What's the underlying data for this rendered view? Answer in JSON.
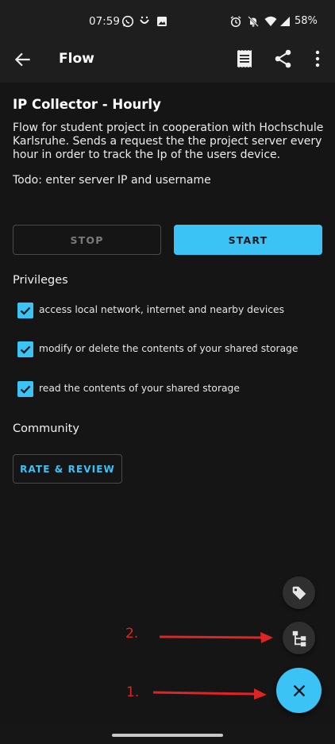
{
  "status_bar": {
    "time": "07:59",
    "battery": "58%",
    "icons": [
      "whatsapp-icon",
      "smile-app-icon",
      "image-icon",
      "alarm-icon",
      "bell-off-icon",
      "wifi-icon",
      "signal-icon",
      "battery-icon"
    ]
  },
  "app_bar": {
    "title": "Flow",
    "actions": [
      "log-icon",
      "share-icon",
      "more-vert-icon"
    ]
  },
  "flow": {
    "title": "IP Collector - Hourly",
    "description": "Flow for student project in cooperation with Hochschule Karlsruhe. Sends a request the the project server every hour in order to track the Ip of the users device.",
    "todo": "Todo: enter server IP and username"
  },
  "buttons": {
    "stop": "STOP",
    "start": "START",
    "rate": "RATE & REVIEW"
  },
  "privileges": {
    "title": "Privileges",
    "items": [
      {
        "label": "access local network, internet and nearby devices",
        "checked": true
      },
      {
        "label": "modify or delete the contents of your shared storage",
        "checked": true
      },
      {
        "label": "read the contents of your shared storage",
        "checked": true
      }
    ]
  },
  "community": {
    "title": "Community"
  },
  "fab": {
    "mini_1": "tag-icon",
    "mini_2": "flow-tree-icon",
    "main": "close-icon"
  },
  "annotations": {
    "label_1": "1.",
    "label_2": "2.",
    "color": "#e02424"
  },
  "colors": {
    "accent": "#3cc3f5",
    "background": "#151515",
    "bar": "#1e1e1e"
  }
}
